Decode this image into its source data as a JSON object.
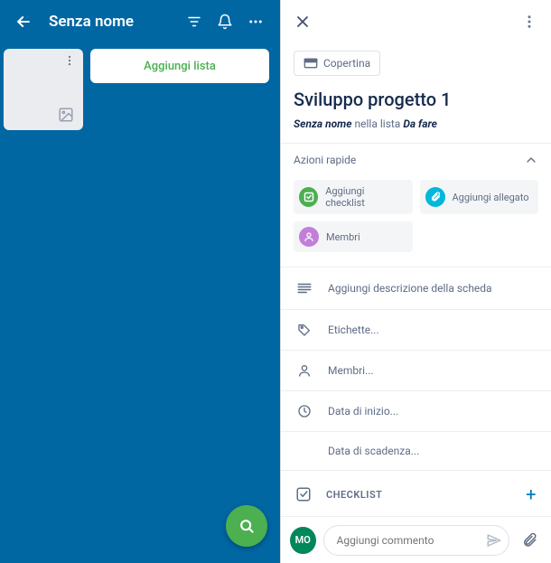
{
  "board": {
    "title": "Senza nome",
    "add_list_label": "Aggiungi lista"
  },
  "card": {
    "cover_label": "Copertina",
    "title": "Sviluppo progetto 1",
    "subtitle_prefix": "Senza nome",
    "subtitle_mid": " nella lista ",
    "subtitle_list": "Da fare",
    "quick_actions_header": "Azioni rapide",
    "quick_actions": {
      "checklist": "Aggiungi checklist",
      "attachment": "Aggiungi allegato",
      "members": "Membri"
    },
    "rows": {
      "description": "Aggiungi descrizione della scheda",
      "labels": "Etichette...",
      "members": "Membri...",
      "start_date": "Data di inizio...",
      "due_date": "Data di scadenza..."
    },
    "checklist_header": "CHECKLIST",
    "truncated_row": "Checklist"
  },
  "comment": {
    "avatar_initials": "MO",
    "placeholder": "Aggiungi commento"
  }
}
